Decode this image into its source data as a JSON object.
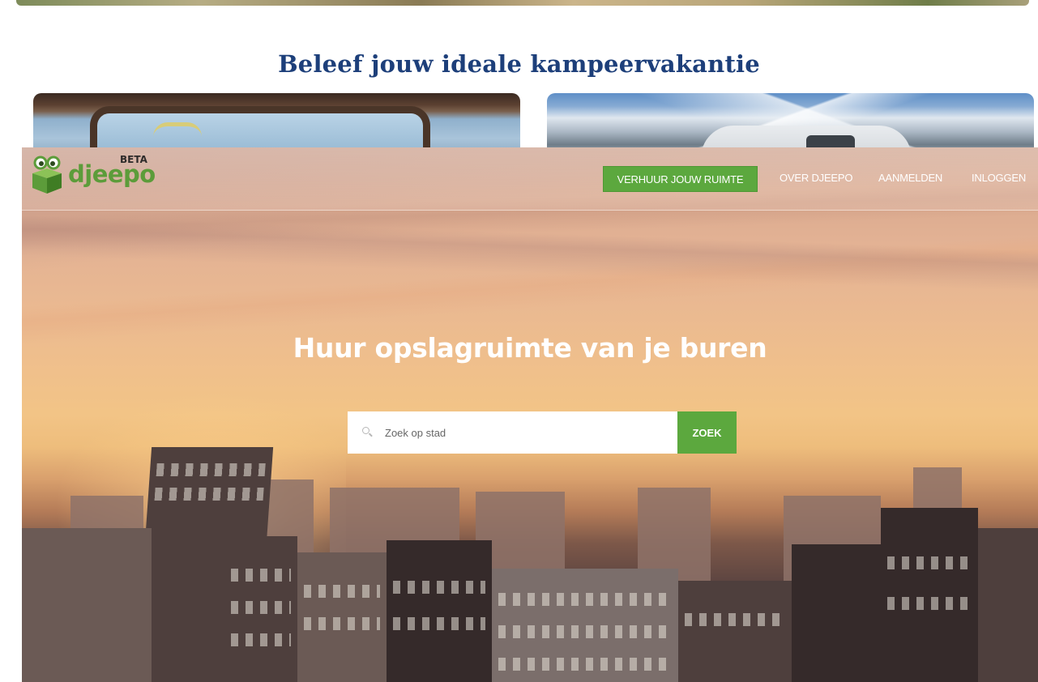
{
  "background_page": {
    "heading": "Beleef jouw ideale kampeervakantie"
  },
  "header": {
    "logo_text": "djeepo",
    "logo_badge": "BETA",
    "nav": {
      "cta_label": "VERHUUR JOUW RUIMTE",
      "links": [
        "OVER DJEEPO",
        "AANMELDEN",
        "INLOGGEN"
      ]
    }
  },
  "hero": {
    "title": "Huur opslagruimte van je buren",
    "search": {
      "placeholder": "Zoek op stad",
      "value": "",
      "button_label": "ZOEK"
    }
  },
  "colors": {
    "brand_green": "#5ca83e",
    "heading_blue": "#1d3f7a"
  },
  "icons": {
    "logo": "package-box-with-eyes-icon",
    "search": "search-icon"
  }
}
